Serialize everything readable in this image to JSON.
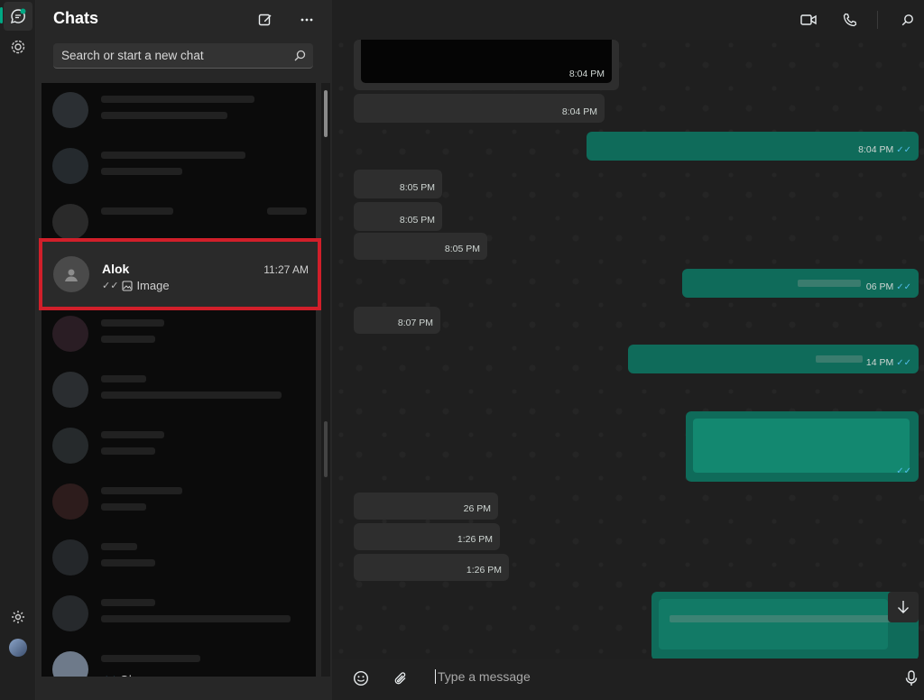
{
  "sidebar": {
    "title": "Chats",
    "search_placeholder": "Search or start a new chat"
  },
  "chat_list": [
    {
      "name": "Alok",
      "preview": "Image",
      "time": "11:27 AM",
      "selected": true
    },
    {
      "name": "",
      "preview": "Ok",
      "time": ""
    }
  ],
  "conversation": {
    "messages": [
      {
        "dir": "in",
        "kind": "image",
        "time": "8:04 PM"
      },
      {
        "dir": "in",
        "time": "8:04 PM"
      },
      {
        "dir": "out",
        "time": "8:04 PM"
      },
      {
        "dir": "in",
        "time": "8:05 PM"
      },
      {
        "dir": "in",
        "time": "8:05 PM"
      },
      {
        "dir": "in",
        "time": "8:05 PM"
      },
      {
        "dir": "out",
        "time": "06 PM"
      },
      {
        "dir": "in",
        "time": "8:07 PM"
      },
      {
        "dir": "out",
        "time": "14 PM"
      },
      {
        "dir": "out",
        "kind": "card",
        "time": ""
      },
      {
        "dir": "in",
        "time": "26 PM"
      },
      {
        "dir": "in",
        "time": "1:26 PM"
      },
      {
        "dir": "in",
        "time": "1:26 PM"
      },
      {
        "dir": "out",
        "kind": "card",
        "time": ""
      }
    ]
  },
  "composer": {
    "placeholder": "Type a message"
  },
  "colors": {
    "accent": "#00a884",
    "outgoing_bubble": "#0f6b5a",
    "incoming_bubble": "#2e2e2e",
    "highlight_border": "#d11f2a",
    "read_tick": "#53bdeb"
  }
}
